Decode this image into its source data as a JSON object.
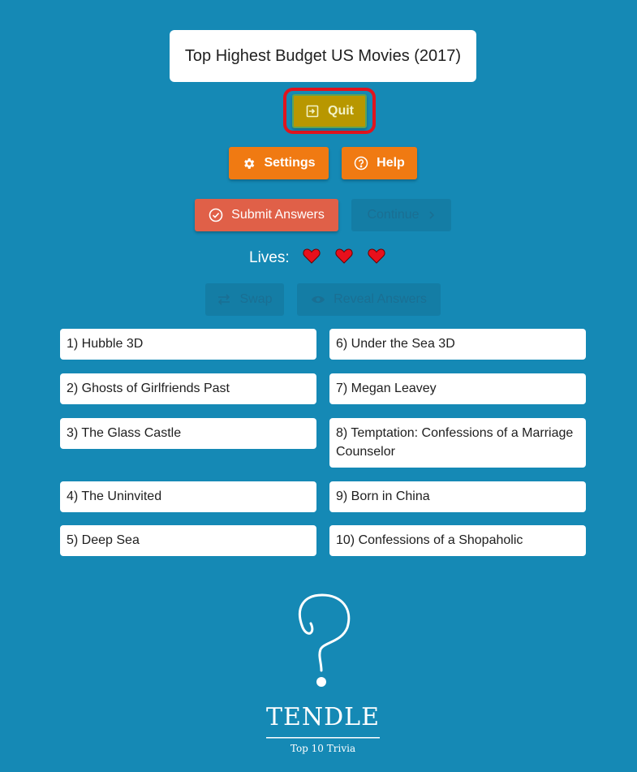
{
  "quiz": {
    "title": "Top Highest Budget US Movies (2017)"
  },
  "buttons": {
    "quit_label": "Quit",
    "settings_label": "Settings",
    "help_label": "Help",
    "submit_label": "Submit Answers",
    "continue_label": "Continue",
    "swap_label": "Swap",
    "reveal_label": "Reveal Answers"
  },
  "lives": {
    "label": "Lives:",
    "count": 3
  },
  "answers": [
    "1) Hubble 3D",
    "2) Ghosts of Girlfriends Past",
    "3) The Glass Castle",
    "4) The Uninvited",
    "5) Deep Sea",
    "6) Under the Sea 3D",
    "7) Megan Leavey",
    "8) Temptation: Confessions of a Marriage Counselor",
    "9) Born in China",
    "10) Confessions of a Shopaholic"
  ],
  "logo": {
    "name": "TENDLE",
    "tagline": "Top 10 Trivia"
  },
  "colors": {
    "background": "#1589b5",
    "accent_orange": "#f07a12",
    "submit": "#e06048",
    "quit": "#b89700",
    "heart": "#e8101c",
    "highlight_ring": "#e0141e"
  },
  "icons": {
    "quit": "sign-in-icon",
    "settings": "gear-icon",
    "help": "question-circle-icon",
    "submit": "check-circle-icon",
    "continue": "chevron-right-icon",
    "swap": "swap-arrows-icon",
    "reveal": "eye-icon",
    "life": "heart-icon"
  }
}
